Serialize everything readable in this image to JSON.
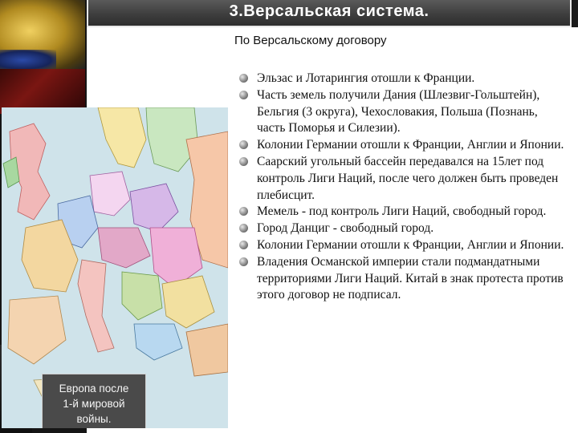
{
  "header": {
    "title": "3.Версальская система."
  },
  "subtitle": "По Версальскому договору",
  "map": {
    "caption_lines": [
      "Европа после",
      "1-й мировой",
      "войны."
    ]
  },
  "items": [
    "Эльзас и Лотарингия отошли к Франции.",
    "Часть земель получили Дания (Шлезвиг-Гольштейн), Бельгия (3 округа), Чехословакия, Польша (Познань, часть Поморья и Силезии).",
    "Колонии Германии отошли к Франции, Англии и Японии.",
    "Саарский угольный бассейн передавался на 15лет под контроль Лиги Наций, после чего должен быть проведен плебисцит.",
    "Мемель - под контроль Лиги Наций, свободный город.",
    "Город Данциг - свободный город.",
    " Колонии Германии отошли к Франции, Англии и Японии.",
    "Владения Османской империи стали подмандатными территориями Лиги Наций. Китай в знак протеста против этого договор не подписал."
  ],
  "icons": {
    "bullet": "sphere-bullet-icon"
  }
}
